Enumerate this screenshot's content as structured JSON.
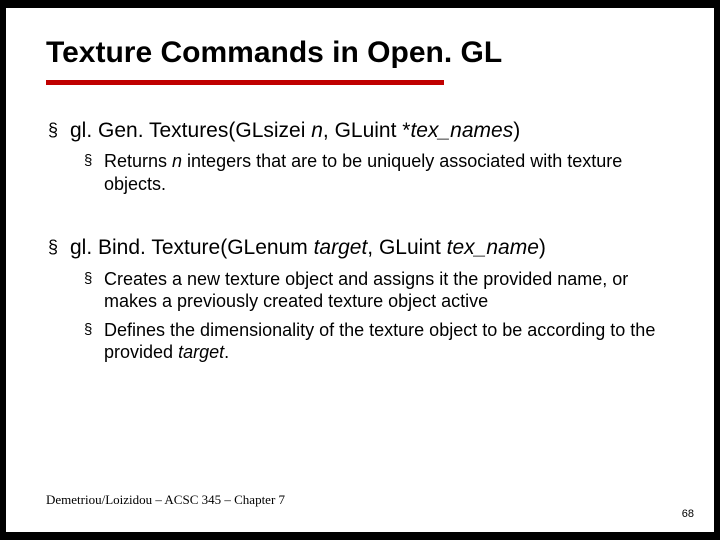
{
  "title": "Texture Commands in Open. GL",
  "items": [
    {
      "sig_a": "gl. Gen. Textures(GLsizei ",
      "sig_b_i": "n",
      "sig_c": ", GLuint *",
      "sig_d_i": "tex_names",
      "sig_e": ")",
      "subs": [
        {
          "a": "Returns ",
          "b_i": "n",
          "c": " integers that are to be uniquely associated with texture objects."
        }
      ]
    },
    {
      "sig_a": "gl. Bind. Texture(GLenum ",
      "sig_b_i": "target",
      "sig_c": ", GLuint ",
      "sig_d_i": "tex_name",
      "sig_e": ")",
      "subs": [
        {
          "a": "Creates a new texture object and assigns it the provided name, or makes a previously created texture object active",
          "b_i": "",
          "c": ""
        },
        {
          "a": "Defines the dimensionality of the texture object to be according to the provided ",
          "b_i": "target",
          "c": "."
        }
      ]
    }
  ],
  "footer_left": "Demetriou/Loizidou – ACSC 345 – Chapter 7",
  "page_number": "68",
  "bullet_glyph": "§"
}
